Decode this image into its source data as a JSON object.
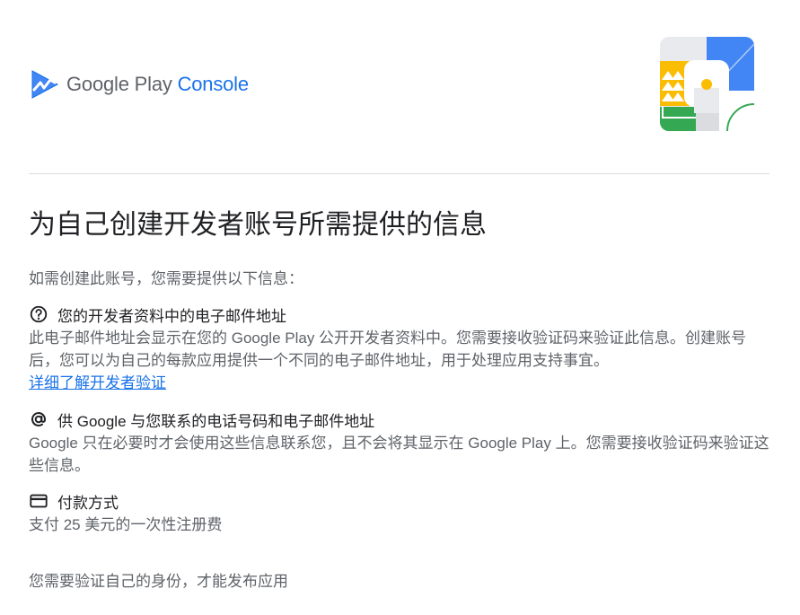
{
  "brand": {
    "google_play": "Google Play ",
    "console": "Console"
  },
  "page": {
    "title": "为自己创建开发者账号所需提供的信息",
    "intro": "如需创建此账号，您需要提供以下信息："
  },
  "sections": [
    {
      "icon": "help-circle-icon",
      "title": "您的开发者资料中的电子邮件地址",
      "description": "此电子邮件地址会显示在您的 Google Play 公开开发者资料中。您需要接收验证码来验证此信息。创建账号后，您可以为自己的每款应用提供一个不同的电子邮件地址，用于处理应用支持事宜。",
      "link": "详细了解开发者验证"
    },
    {
      "icon": "at-sign-icon",
      "title": "供 Google 与您联系的电话号码和电子邮件地址",
      "description": "Google 只在必要时才会使用这些信息联系您，且不会将其显示在 Google Play 上。您需要接收验证码来验证这些信息。"
    },
    {
      "icon": "credit-card-icon",
      "title": "付款方式",
      "description": "支付 25 美元的一次性注册费"
    }
  ],
  "footer": {
    "note": "您需要验证自己的身份，才能发布应用"
  },
  "colors": {
    "brand_blue": "#1a73e8",
    "text_primary": "#202124",
    "text_secondary": "#5f6368",
    "divider": "#dadce0",
    "illustration_yellow": "#fbbc04",
    "illustration_green": "#34a853",
    "illustration_blue": "#4285f4"
  }
}
